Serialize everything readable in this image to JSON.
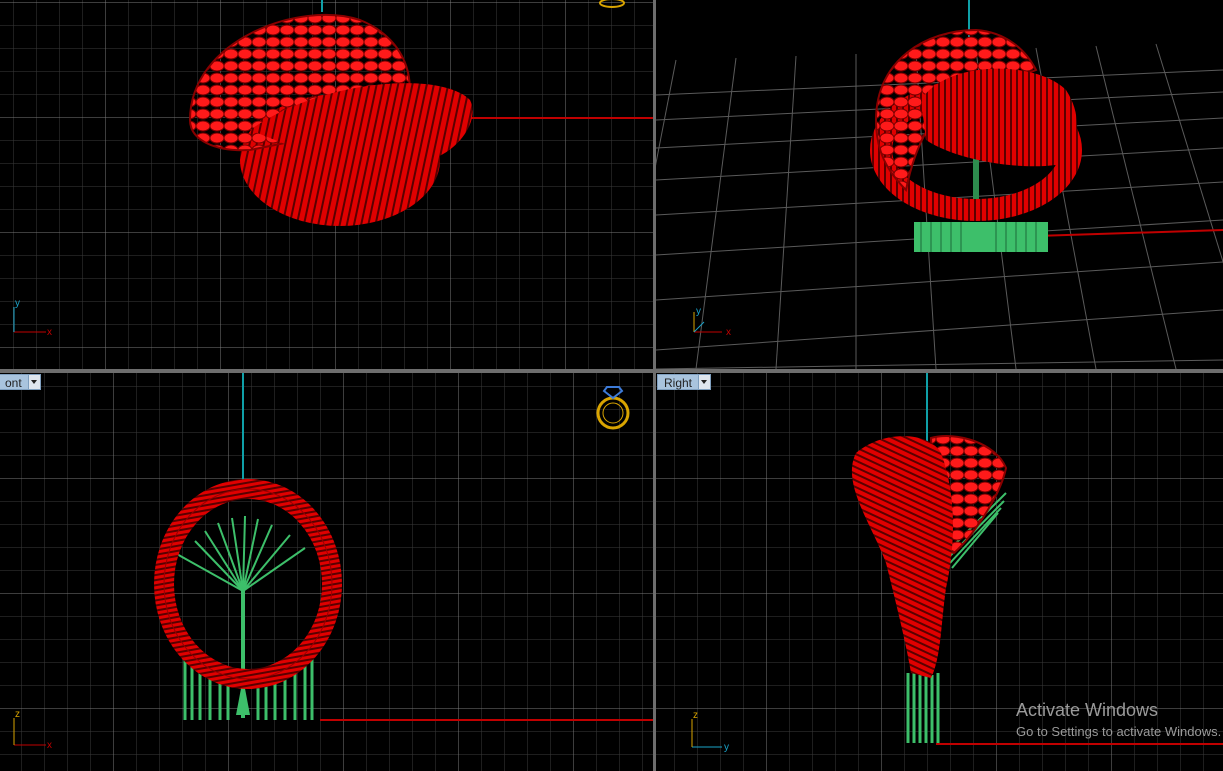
{
  "viewports": {
    "top": {
      "axis_x": "x",
      "axis_y": "y"
    },
    "perspective": {
      "axis_x": "x",
      "axis_y": "y"
    },
    "front": {
      "label": "ont",
      "axis_x": "x",
      "axis_y": "z"
    },
    "right": {
      "label": "Right",
      "axis_x": "y",
      "axis_y": "z"
    }
  },
  "watermark": {
    "title": "Activate Windows",
    "subtitle": "Go to Settings to activate Windows."
  },
  "colors": {
    "model": "#e00000",
    "support": "#3dbf6a",
    "grid": "#3b3b3b",
    "grid_major": "#8a8a8a",
    "axis_red": "#c00000",
    "axis_blue": "#0fa0a8"
  }
}
